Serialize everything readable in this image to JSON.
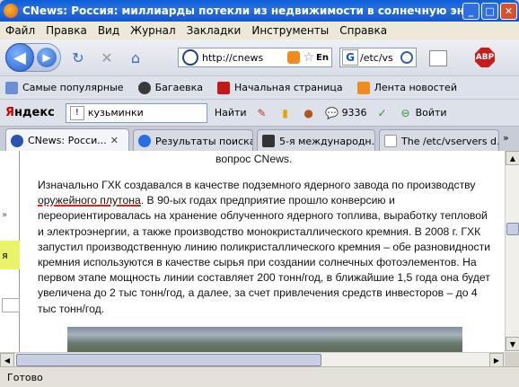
{
  "window": {
    "title": "CNews: Россия: миллиарды потекли из недвижимости в солнечную энергетику - Mozilla ..."
  },
  "menu": [
    "Файл",
    "Правка",
    "Вид",
    "Журнал",
    "Закладки",
    "Инструменты",
    "Справка"
  ],
  "nav": {
    "url": "http://cnews",
    "lang": "En",
    "search_value": "/etc/vs",
    "search_engine_icon": "G",
    "abp_label": "ABP"
  },
  "bookmarks": [
    {
      "label": "Самые популярные",
      "icon": "bookmark-page-icon"
    },
    {
      "label": "Багаевка",
      "icon": "bug-icon"
    },
    {
      "label": "Начальная страница",
      "icon": "red-bird-icon"
    },
    {
      "label": "Лента новостей",
      "icon": "rss-icon"
    }
  ],
  "yandex": {
    "logo_red": "Я",
    "logo_rest": "ндекс",
    "query": "кузьминки",
    "find_label": "Найти",
    "count": "9336",
    "login_label": "Войти"
  },
  "tabs": [
    {
      "label": "CNews: Росси...",
      "active": true
    },
    {
      "label": "Результаты поиска",
      "active": false
    },
    {
      "label": "5-я международн...",
      "active": false
    },
    {
      "label": "The /etc/vservers d...",
      "active": false
    }
  ],
  "article": {
    "top_line": "вопрос CNews.",
    "p1_before": "Изначально ГХК создавался в качестве подземного ядерного завода по производству ",
    "p1_underlined": "оружейного плутона",
    "p1_after": ". В 90-ых годах предприятие прошло конверсию и переориентировалась на хранение облученного ядерного топлива, выработку тепловой и электроэнергии, а также производство монокристаллического кремния. В 2008 г. ГХК запустил производственную линию поликристаллического кремния – обе разновидности кремния используются в качестве сырья при создании солнечных фотоэлементов. На первом этапе мощность линии составляет 200 тонн/год, в ближайшие 1,5 года она будет увеличена до 2 тыс тонн/год, а далее, за счет привлечения средств инвесторов – до 4 тыс тонн/год.",
    "side_marker": "»",
    "side_highlight": "я"
  },
  "status": {
    "text": "Готово"
  }
}
